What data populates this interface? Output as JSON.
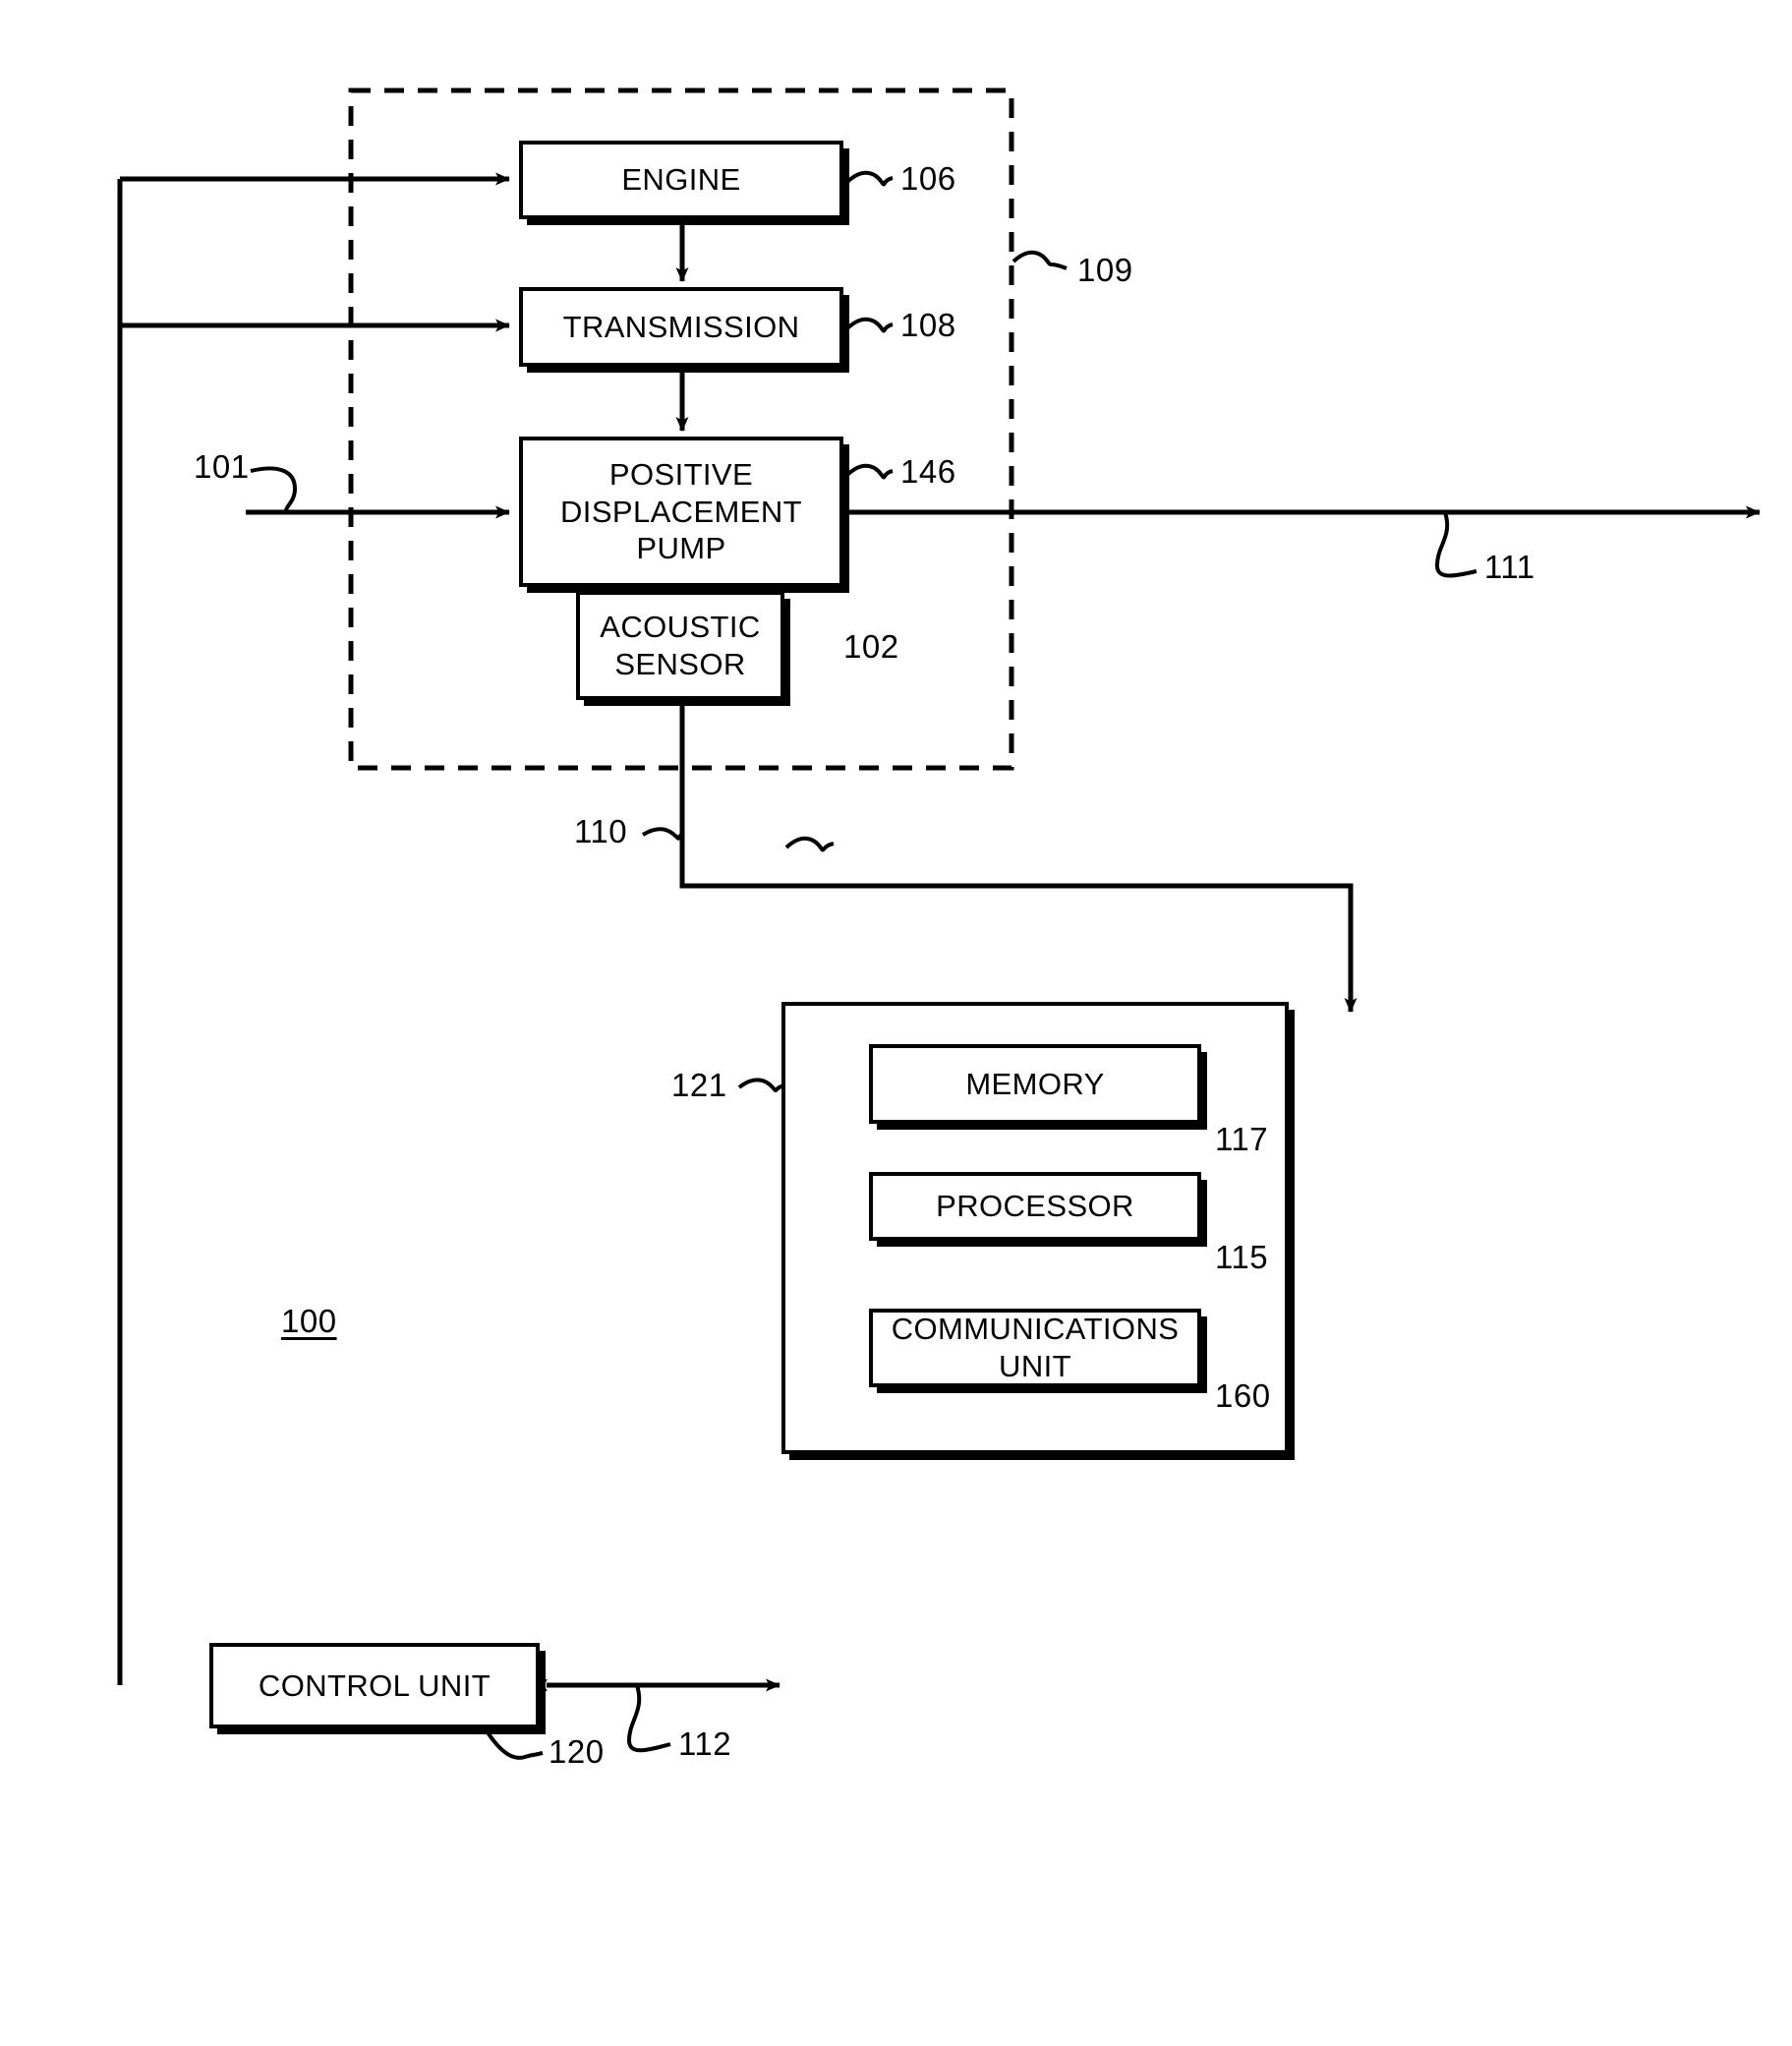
{
  "figure": {
    "identifier": "100",
    "blocks": {
      "engine": "ENGINE",
      "transmission": "TRANSMISSION",
      "pump": "POSITIVE\nDISPLACEMENT\nPUMP",
      "acoustic_sensor": "ACOUSTIC\nSENSOR",
      "control_unit": "CONTROL UNIT",
      "memory": "MEMORY",
      "processor": "PROCESSOR",
      "communications_unit": "COMMUNICATIONS\nUNIT"
    },
    "reference_numerals": {
      "engine": "106",
      "transmission": "108",
      "dashed_enclosure": "109",
      "pump": "146",
      "acoustic_sensor": "102",
      "inlet_line": "101",
      "outlet_line": "111",
      "sensor_signal_line": "110",
      "computer_enclosure": "121",
      "memory": "117",
      "processor": "115",
      "communications_unit": "160",
      "control_unit": "120",
      "control_link": "112"
    },
    "colors": {
      "stroke": "#000000",
      "background": "#ffffff"
    }
  }
}
